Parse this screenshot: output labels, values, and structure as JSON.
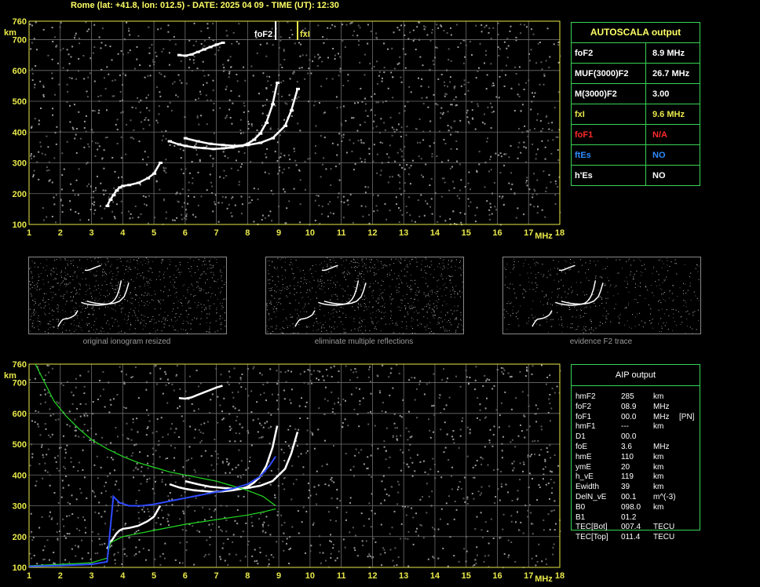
{
  "header": {
    "title": "Rome (lat: +41.8, lon: 012.5) - DATE: 2025 04 09 - TIME (UT): 12:30"
  },
  "colors": {
    "grid": "#6e6e6e",
    "axis": "#e8e84a",
    "panel_border": "#39d353",
    "profile": "#22dd22",
    "virtual": "#2e4bff",
    "fof1": "#ff2a2a",
    "ftes": "#2f8cff",
    "fxi": "#e8e84a"
  },
  "chart_data": [
    {
      "type": "scatter",
      "panel": "autoscala-ionogram",
      "ylabel": "km",
      "xlabel": "MHz",
      "xlim": [
        1,
        18
      ],
      "ylim": [
        100,
        760
      ],
      "xticks": [
        "1",
        "2",
        "3",
        "4",
        "5",
        "6",
        "7",
        "8",
        "9",
        "10",
        "11",
        "12",
        "13",
        "14",
        "15",
        "16",
        "17",
        "18"
      ],
      "yticks": [
        "100",
        "200",
        "300",
        "400",
        "500",
        "600",
        "700",
        "760"
      ],
      "markers": [
        {
          "label": "foF2",
          "x": 8.9
        },
        {
          "label": "fxI",
          "x": 9.6
        }
      ],
      "traces": [
        {
          "x": [
            3.5,
            3.6,
            3.7,
            3.8,
            3.9,
            4.0,
            4.2,
            4.5,
            4.8,
            5.0,
            5.2
          ],
          "y": [
            160,
            180,
            195,
            210,
            220,
            225,
            228,
            235,
            250,
            265,
            300
          ]
        },
        {
          "x": [
            5.5,
            5.8,
            6.0,
            6.3,
            6.6,
            6.9,
            7.2,
            7.5,
            7.8,
            8.0,
            8.2,
            8.4,
            8.6,
            8.8,
            8.95
          ],
          "y": [
            370,
            360,
            355,
            350,
            348,
            345,
            347,
            350,
            355,
            362,
            375,
            395,
            430,
            490,
            560
          ]
        },
        {
          "x": [
            6.0,
            6.4,
            6.8,
            7.2,
            7.6,
            8.0,
            8.4,
            8.8,
            9.2,
            9.4,
            9.6
          ],
          "y": [
            380,
            370,
            362,
            358,
            355,
            358,
            365,
            380,
            420,
            470,
            540
          ]
        },
        {
          "x": [
            5.8,
            6.0,
            6.2,
            6.4,
            6.6,
            6.8,
            7.0,
            7.2
          ],
          "y": [
            650,
            648,
            652,
            660,
            668,
            676,
            684,
            690
          ]
        }
      ]
    },
    {
      "type": "line",
      "panel": "aip-ionogram",
      "ylabel": "km",
      "xlabel": "MHz",
      "xlim": [
        1,
        18
      ],
      "ylim": [
        100,
        760
      ],
      "xticks": [
        "1",
        "2",
        "3",
        "4",
        "5",
        "6",
        "7",
        "8",
        "9",
        "10",
        "11",
        "12",
        "13",
        "14",
        "15",
        "16",
        "17",
        "18"
      ],
      "yticks": [
        "100",
        "200",
        "300",
        "400",
        "500",
        "600",
        "700",
        "760"
      ],
      "series": [
        {
          "x": [
            1.2,
            1.5,
            1.8,
            2.2,
            2.6,
            3.0,
            3.5,
            4.0,
            4.5,
            5.0,
            5.5,
            6.0,
            6.5,
            7.0,
            7.5,
            8.0,
            8.5,
            8.9
          ],
          "y": [
            760,
            700,
            640,
            590,
            550,
            515,
            485,
            460,
            440,
            425,
            410,
            400,
            390,
            380,
            365,
            350,
            330,
            300
          ]
        },
        {
          "x": [
            1.0,
            2.0,
            3.0,
            3.5,
            3.6,
            4.0,
            4.5,
            5.0,
            6.0,
            7.0,
            8.0,
            8.5,
            8.9
          ],
          "y": [
            105,
            110,
            115,
            130,
            180,
            200,
            210,
            220,
            240,
            255,
            270,
            280,
            290
          ]
        },
        {
          "x": [
            1.0,
            2.0,
            3.0,
            3.5,
            3.7,
            3.9,
            4.2,
            4.6,
            5.0,
            5.5,
            6.0,
            6.5,
            7.0,
            7.5,
            8.0,
            8.4,
            8.7,
            8.9
          ],
          "y": [
            103,
            106,
            110,
            118,
            330,
            310,
            300,
            300,
            305,
            315,
            325,
            335,
            345,
            355,
            370,
            395,
            430,
            460
          ]
        }
      ]
    }
  ],
  "autoscala": {
    "header": "AUTOSCALA output",
    "rows": [
      {
        "key": "foF2",
        "value": "8.9 MHz",
        "color": "#ffffff"
      },
      {
        "key": "MUF(3000)F2",
        "value": "26.7 MHz",
        "color": "#ffffff"
      },
      {
        "key": "M(3000)F2",
        "value": "3.00",
        "color": "#ffffff"
      },
      {
        "key": "fxI",
        "value": "9.6 MHz",
        "color": "#e8e84a"
      },
      {
        "key": "foF1",
        "value": "N/A",
        "color": "#ff2a2a"
      },
      {
        "key": "ftEs",
        "value": "NO",
        "color": "#2f8cff"
      },
      {
        "key": "h'Es",
        "value": "NO",
        "color": "#ffffff"
      }
    ]
  },
  "aip": {
    "header": "AIP output",
    "rows": [
      {
        "param": "hmF2",
        "value": "285",
        "unit": "km",
        "extra": ""
      },
      {
        "param": "foF2",
        "value": "08.9",
        "unit": "MHz",
        "extra": ""
      },
      {
        "param": "foF1",
        "value": "00.0",
        "unit": "MHz",
        "extra": "[PN]"
      },
      {
        "param": "hmF1",
        "value": "---",
        "unit": "km",
        "extra": ""
      },
      {
        "param": "D1",
        "value": "00.0",
        "unit": "",
        "extra": ""
      },
      {
        "param": "foE",
        "value": "3.6",
        "unit": "MHz",
        "extra": ""
      },
      {
        "param": "hmE",
        "value": "110",
        "unit": "km",
        "extra": ""
      },
      {
        "param": "ymE",
        "value": "20",
        "unit": "km",
        "extra": ""
      },
      {
        "param": "h_vE",
        "value": "119",
        "unit": "km",
        "extra": ""
      },
      {
        "param": "Ewidth",
        "value": "39",
        "unit": "km",
        "extra": ""
      },
      {
        "param": "DelN_vE",
        "value": "00.1",
        "unit": "m^(-3)",
        "extra": ""
      },
      {
        "param": "B0",
        "value": "098.0",
        "unit": "km",
        "extra": ""
      },
      {
        "param": "B1",
        "value": "01.2",
        "unit": "",
        "extra": ""
      },
      {
        "param": "TEC[Bot]",
        "value": "007.4",
        "unit": "TECU",
        "extra": ""
      },
      {
        "param": "TEC[Top]",
        "value": "011.4",
        "unit": "TECU",
        "extra": ""
      }
    ]
  },
  "thumbnails": [
    {
      "caption": "original ionogram resized"
    },
    {
      "caption": "eliminate multiple reflections"
    },
    {
      "caption": "evidence F2 trace"
    }
  ]
}
